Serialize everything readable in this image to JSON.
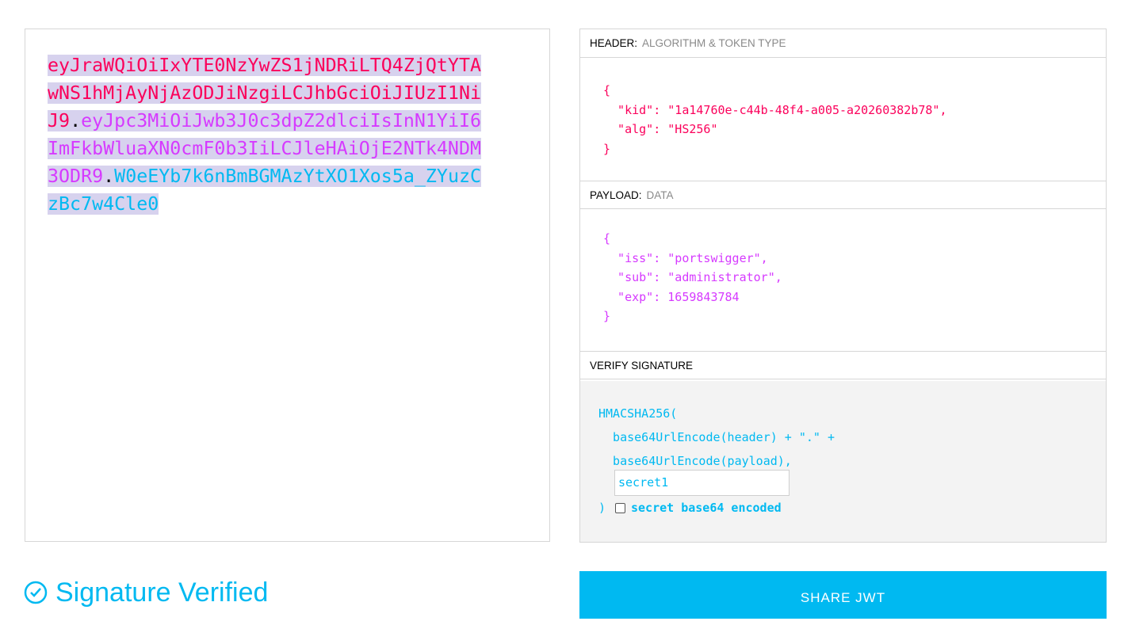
{
  "encoded": {
    "header": "eyJraWQiOiIxYTE0NzYwZS1jNDRiLTQ4ZjQtYTAwNS1hMjAyNjAzODJiNzgiLCJhbGciOiJIUzI1NiJ9",
    "dot1": ".",
    "payload": "eyJpc3MiOiJwb3J0c3dpZ2dlciIsInN1YiI6ImFkbWluaXN0cmF0b3IiLCJleHAiOjE2NTk4NDM3ODR9",
    "dot2": ".",
    "signature": "W0eEYb7k6nBmBGMAzYtXO1Xos5a_ZYuzCzBc7w4Cle0"
  },
  "header_section": {
    "label": "HEADER:",
    "sublabel": "ALGORITHM & TOKEN TYPE",
    "json": "{\n  \"kid\": \"1a14760e-c44b-48f4-a005-a20260382b78\",\n  \"alg\": \"HS256\"\n}"
  },
  "payload_section": {
    "label": "PAYLOAD:",
    "sublabel": "DATA",
    "json": "{\n  \"iss\": \"portswigger\",\n  \"sub\": \"administrator\",\n  \"exp\": 1659843784\n}"
  },
  "verify_section": {
    "label": "VERIFY SIGNATURE",
    "line1": "HMACSHA256(",
    "line2": "  base64UrlEncode(header) + \".\" +",
    "line3": "  base64UrlEncode(payload),",
    "secret_value": "secret1",
    "close": ")",
    "checkbox_label": "secret base64 encoded",
    "checkbox_checked": false
  },
  "status": {
    "text": "Signature Verified"
  },
  "share_button": {
    "label": "SHARE JWT"
  },
  "colors": {
    "header": "#fb015b",
    "payload": "#d63aff",
    "signature": "#00b9f1"
  }
}
